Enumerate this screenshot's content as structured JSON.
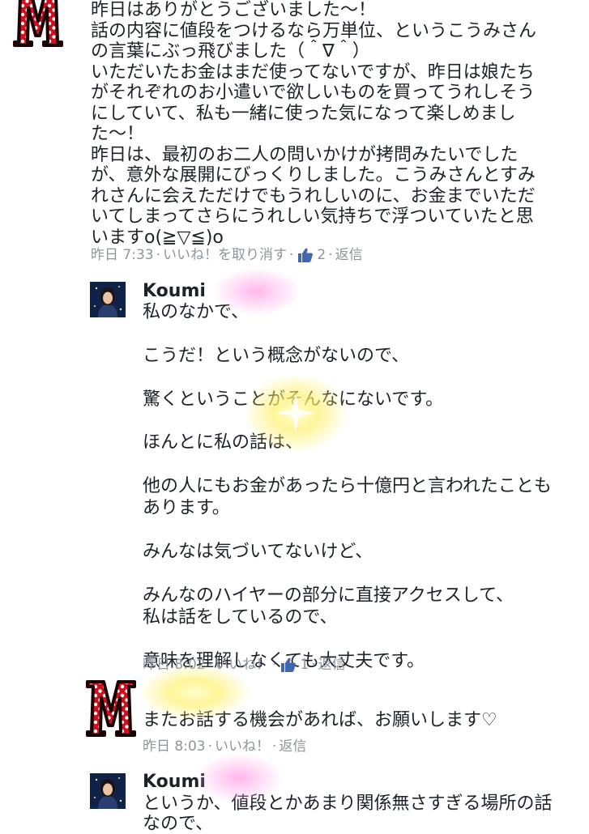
{
  "comments": [
    {
      "author": "",
      "avatar_icon": "letter-m-polka-dot-avatar",
      "text": "昨日はありがとうございました〜！\n話の内容に値段をつけるなら万単位、というこうみさん\nの言葉にぶっ飛びました（＾∇＾）\nいただいたお金はまだ使ってないですが、昨日は娘たち\nがそれぞれのお小遣いで欲しいものを買ってうれしそう\nにしていて、私も一緒に使った気になって楽しめまし\nた〜！\n昨日は、最初のお二人の問いかけが拷問みたいでした\nが、意外な展開にびっくりしました。こうみさんとすみ\nれさんに会えただけでもうれしいのに、お金までいただ\nいてしまってさらにうれしい気持ちで浮ついていたと思\nいますo(≧▽≦)o",
      "time": "昨日 7:33",
      "like_action": "いいね！を取り消す",
      "like_count": "2",
      "reply": "返信"
    },
    {
      "author": "Koumi",
      "avatar_icon": "profile-photo",
      "text": "私のなかで、\n\nこうだ！という概念がないので、\n\n驚くということがそんなにないです。\n\nほんとに私の話は、\n\n他の人にもお金があったら十億円と言われたことも\nあります。\n\nみんなは気づいてないけど、\n\nみんなのハイヤーの部分に直接アクセスして、\n私は話をしているので、\n\n意味を理解しなくても大丈夫です。",
      "time": "昨日 8:02",
      "like_action": "いいね！",
      "like_count": "1",
      "reply": "返信"
    },
    {
      "author": "",
      "avatar_icon": "letter-m-polka-dot-avatar",
      "text": "またお話する機会があれば、お願いします♡",
      "time": "昨日 8:03",
      "like_action": "いいね！",
      "reply": "返信"
    },
    {
      "author": "Koumi",
      "avatar_icon": "profile-photo",
      "text": "というか、値段とかあまり関係無さすぎる場所の話\nなので、"
    }
  ],
  "colors": {
    "text": "#1d2129",
    "meta": "#90949c",
    "like_blue": "#4267b2",
    "m_red": "#d10f1f"
  }
}
